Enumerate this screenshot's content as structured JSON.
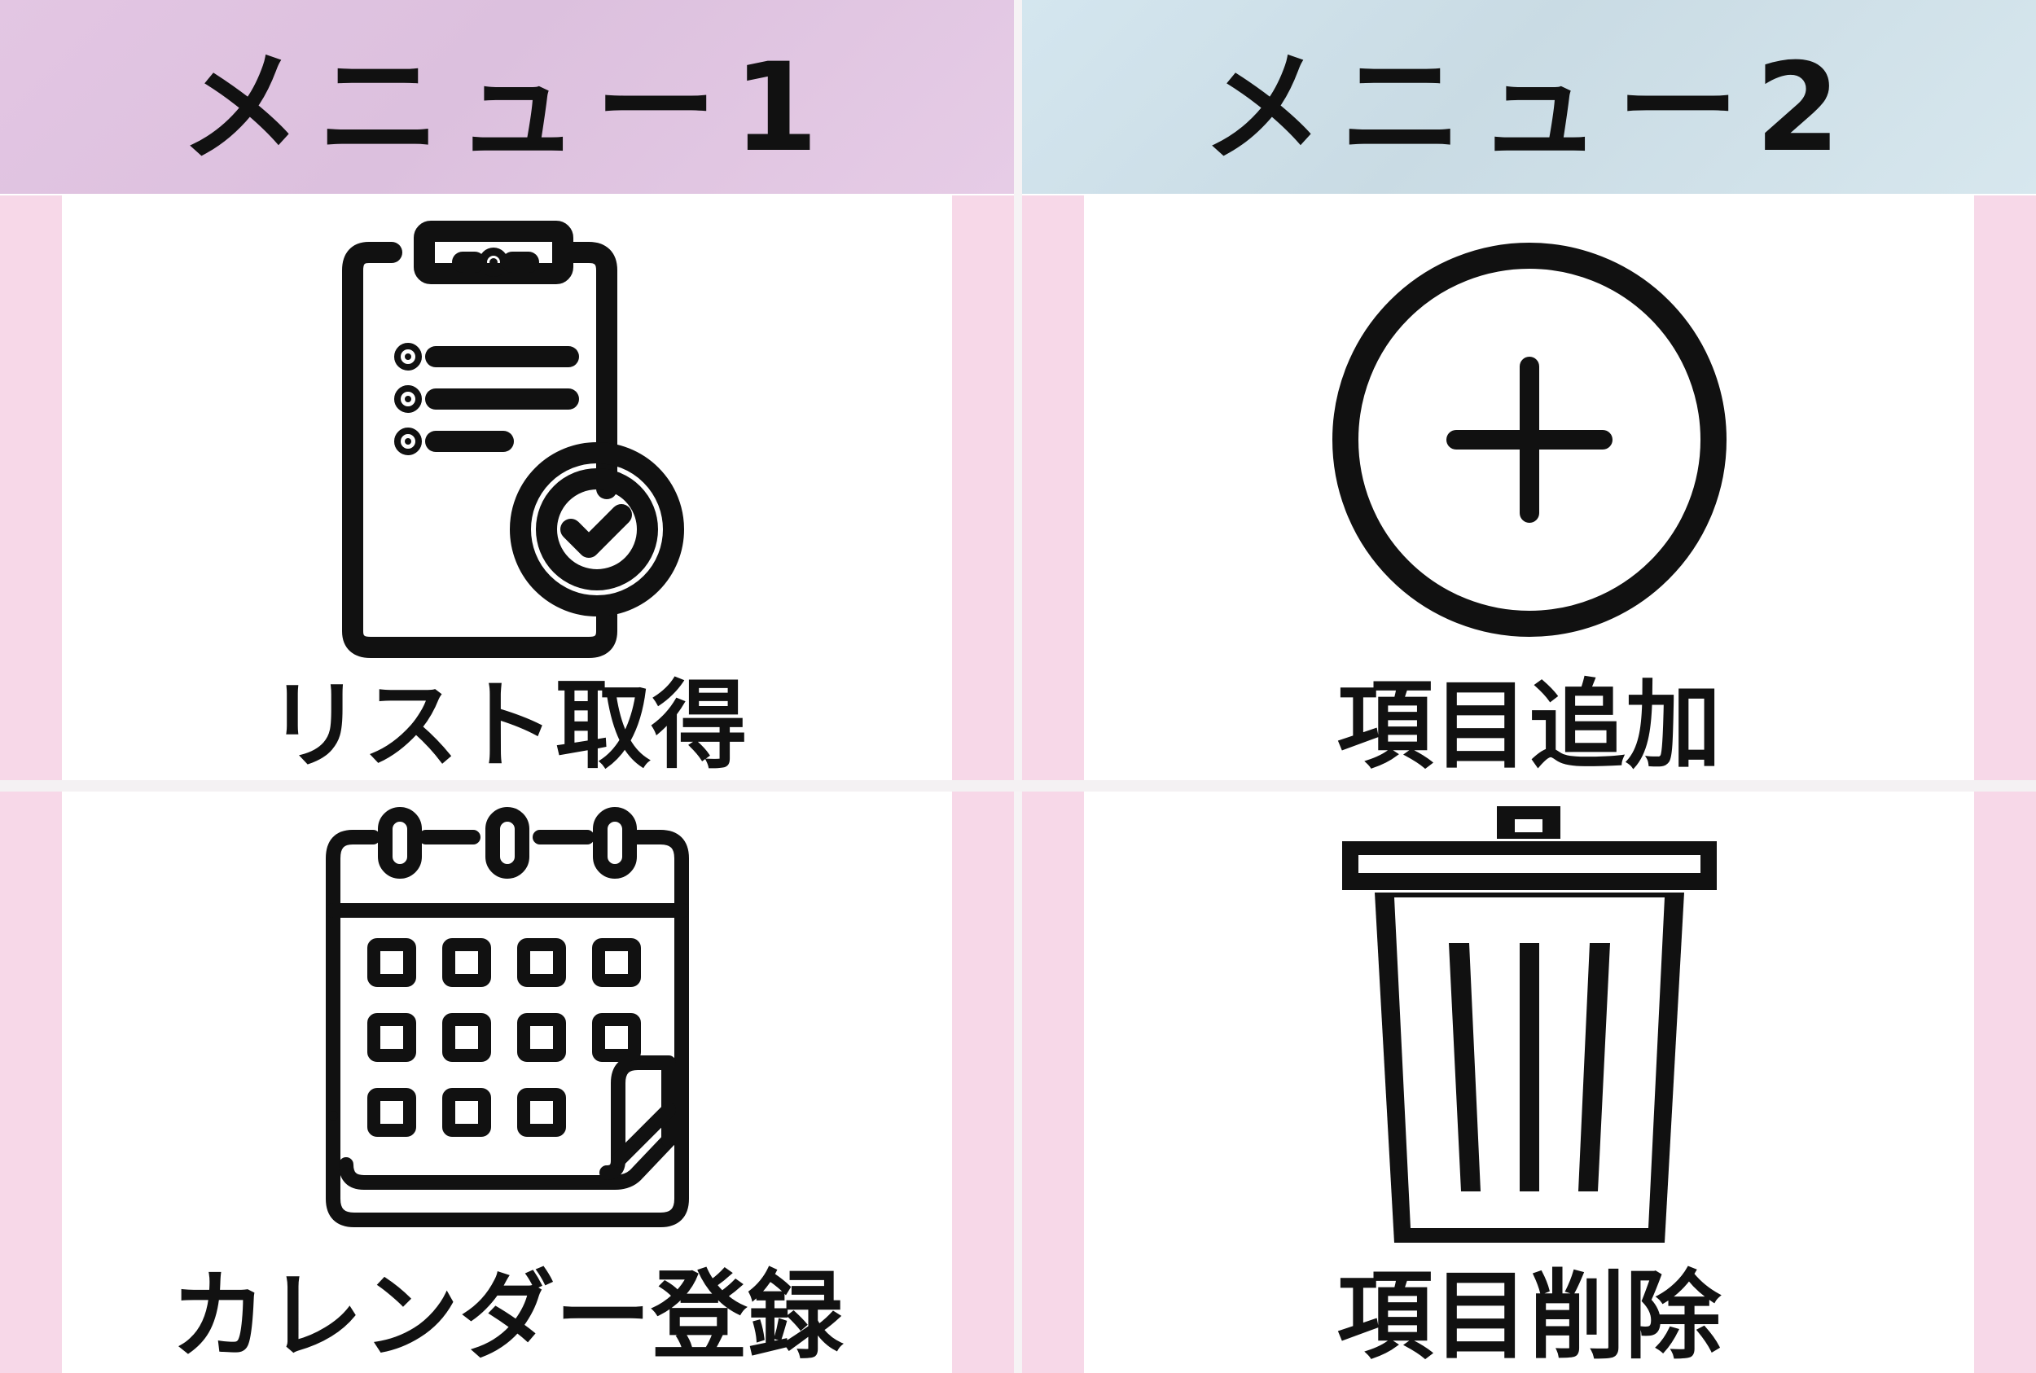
{
  "headers": {
    "menu1": "メニュー1",
    "menu2": "メニュー2"
  },
  "tiles": {
    "list": {
      "label": "リスト取得",
      "icon": "clipboard-check-icon"
    },
    "add": {
      "label": "項目追加",
      "icon": "plus-circle-icon"
    },
    "calendar": {
      "label": "カレンダー登録",
      "icon": "calendar-icon"
    },
    "delete": {
      "label": "項目削除",
      "icon": "trash-icon"
    }
  },
  "colors": {
    "menu1_header": "#e0c4e0",
    "menu2_header": "#cfe1ea",
    "tile_stripe": "#f7d8e8",
    "icon_stroke": "#111111"
  }
}
